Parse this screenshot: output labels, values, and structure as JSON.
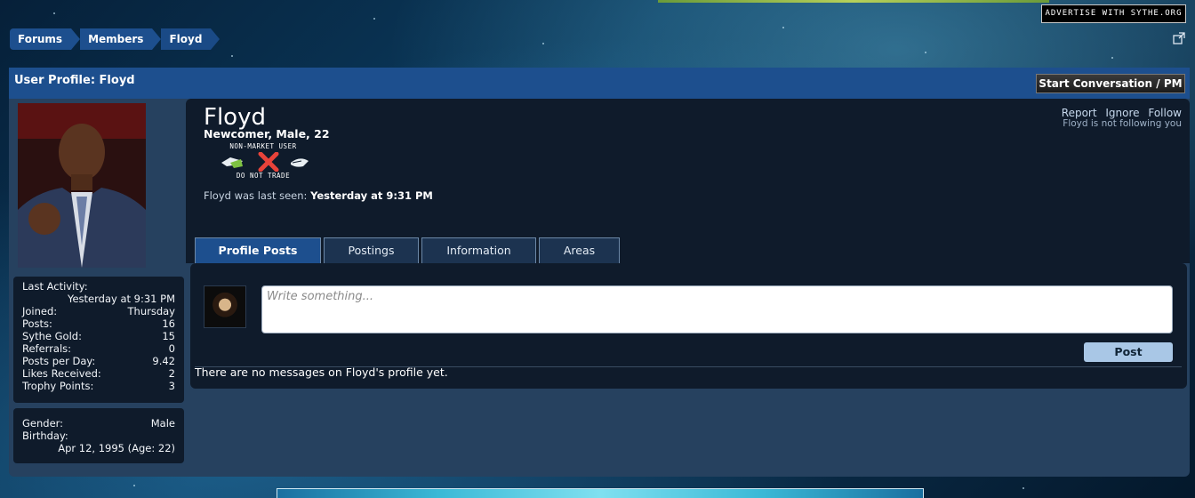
{
  "ad": {
    "label": "ADVERTISE WITH SYTHE.ORG"
  },
  "breadcrumb": [
    "Forums",
    "Members",
    "Floyd"
  ],
  "title_bar": {
    "title": "User Profile: Floyd",
    "start_conversation": "Start Conversation / PM"
  },
  "profile": {
    "name": "Floyd",
    "subtitle": "Newcomer, Male, 22",
    "trade_status_top": "NON-MARKET USER",
    "trade_status_bottom": "DO NOT TRADE",
    "last_seen_label": "Floyd was last seen:",
    "last_seen_value": "Yesterday at 9:31 PM",
    "actions": [
      "Report",
      "Ignore",
      "Follow"
    ],
    "follow_status": "Floyd is not following you"
  },
  "stats": {
    "last_activity_label": "Last Activity:",
    "last_activity_value": "Yesterday at 9:31 PM",
    "rows": [
      {
        "label": "Joined:",
        "value": "Thursday"
      },
      {
        "label": "Posts:",
        "value": "16"
      },
      {
        "label": "Sythe Gold:",
        "value": "15"
      },
      {
        "label": "Referrals:",
        "value": "0"
      },
      {
        "label": "Posts per Day:",
        "value": "9.42"
      },
      {
        "label": "Likes Received:",
        "value": "2"
      },
      {
        "label": "Trophy Points:",
        "value": "3"
      }
    ]
  },
  "info": {
    "gender_label": "Gender:",
    "gender_value": "Male",
    "birthday_label": "Birthday:",
    "birthday_value": "Apr 12, 1995 (Age: 22)"
  },
  "tabs": [
    {
      "label": "Profile Posts",
      "active": true
    },
    {
      "label": "Postings",
      "active": false
    },
    {
      "label": "Information",
      "active": false
    },
    {
      "label": "Areas",
      "active": false
    }
  ],
  "profile_posts": {
    "placeholder": "Write something...",
    "post_button": "Post",
    "empty_message": "There are no messages on Floyd's profile yet."
  },
  "colors": {
    "accent": "#1d4f8e",
    "panel": "#0f1b2b",
    "frame": "#26415f",
    "post_button": "#a9c7e6"
  }
}
